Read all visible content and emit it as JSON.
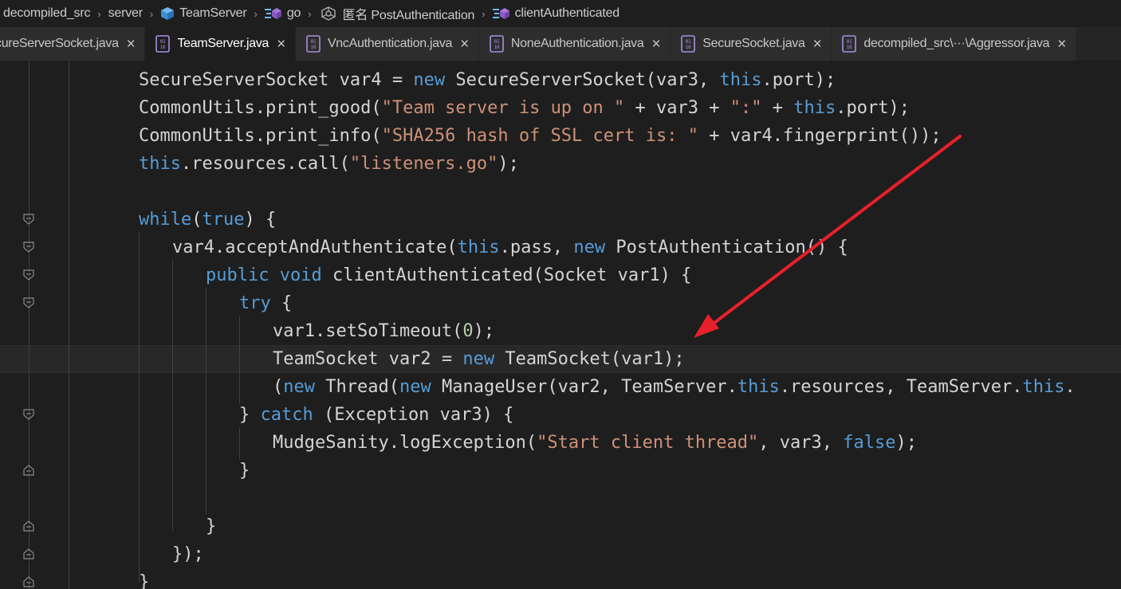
{
  "breadcrumb": {
    "items": [
      "decompiled_src",
      "server",
      "TeamServer",
      "go",
      "匿名 PostAuthentication",
      "clientAuthenticated"
    ]
  },
  "tabs": [
    {
      "label": "cureServerSocket.java",
      "active": false
    },
    {
      "label": "TeamServer.java",
      "active": true
    },
    {
      "label": "VncAuthentication.java",
      "active": false
    },
    {
      "label": "NoneAuthentication.java",
      "active": false
    },
    {
      "label": "SecureSocket.java",
      "active": false
    },
    {
      "label": "decompiled_src\\···\\Aggressor.java",
      "active": false
    }
  ],
  "close_glyph": "×",
  "code": {
    "lines": [
      [
        [
          "",
          "SecureServerSocket var4 = "
        ],
        [
          "kw",
          "new"
        ],
        [
          "",
          " SecureServerSocket(var3, "
        ],
        [
          "kw",
          "this"
        ],
        [
          "",
          ".port);"
        ]
      ],
      [
        [
          "",
          "CommonUtils.print_good("
        ],
        [
          "str",
          "\"Team server is up on \""
        ],
        [
          "",
          " + var3 + "
        ],
        [
          "str",
          "\":\""
        ],
        [
          "",
          " + "
        ],
        [
          "kw",
          "this"
        ],
        [
          "",
          ".port);"
        ]
      ],
      [
        [
          "",
          "CommonUtils.print_info("
        ],
        [
          "str",
          "\"SHA256 hash of SSL cert is: \""
        ],
        [
          "",
          " + var4.fingerprint());"
        ]
      ],
      [
        [
          "kw",
          "this"
        ],
        [
          "",
          ".resources.call("
        ],
        [
          "str",
          "\"listeners.go\""
        ],
        [
          "",
          ");"
        ]
      ],
      [],
      [
        [
          "kw",
          "while"
        ],
        [
          "",
          "("
        ],
        [
          "kw",
          "true"
        ],
        [
          "",
          ") {"
        ]
      ],
      [
        [
          "",
          "var4.acceptAndAuthenticate("
        ],
        [
          "kw",
          "this"
        ],
        [
          "",
          ".pass, "
        ],
        [
          "kw",
          "new"
        ],
        [
          "",
          " PostAuthentication() {"
        ]
      ],
      [
        [
          "kw",
          "public"
        ],
        [
          "",
          " "
        ],
        [
          "kw",
          "void"
        ],
        [
          "",
          " clientAuthenticated(Socket var1) {"
        ]
      ],
      [
        [
          "kw",
          "try"
        ],
        [
          "",
          " {"
        ]
      ],
      [
        [
          "",
          "var1.setSoTimeout("
        ],
        [
          "num",
          "0"
        ],
        [
          "",
          ");"
        ]
      ],
      [
        [
          "",
          "TeamSocket var2 = "
        ],
        [
          "kw",
          "new"
        ],
        [
          "",
          " TeamSocket(var1);"
        ]
      ],
      [
        [
          "",
          "("
        ],
        [
          "kw",
          "new"
        ],
        [
          "",
          " Thread("
        ],
        [
          "kw",
          "new"
        ],
        [
          "",
          " ManageUser(var2, TeamServer."
        ],
        [
          "kw",
          "this"
        ],
        [
          "",
          ".resources, TeamServer."
        ],
        [
          "kw",
          "this"
        ],
        [
          "",
          "."
        ]
      ],
      [
        [
          "",
          "} "
        ],
        [
          "kw",
          "catch"
        ],
        [
          "",
          " (Exception var3) {"
        ]
      ],
      [
        [
          "",
          "MudgeSanity.logException("
        ],
        [
          "str",
          "\"Start client thread\""
        ],
        [
          "",
          ", var3, "
        ],
        [
          "kw",
          "false"
        ],
        [
          "",
          ");"
        ]
      ],
      [
        [
          "",
          "}"
        ]
      ],
      [],
      [
        [
          "",
          "}"
        ]
      ],
      [
        [
          "",
          "});"
        ]
      ],
      [
        [
          "",
          "}"
        ]
      ]
    ]
  },
  "colors": {
    "keyword": "#569cd6",
    "string": "#ce9178",
    "number": "#b5cea8",
    "text": "#d4d4d4",
    "arrow": "#e8202a",
    "cube_icon": "#4da3e8"
  }
}
